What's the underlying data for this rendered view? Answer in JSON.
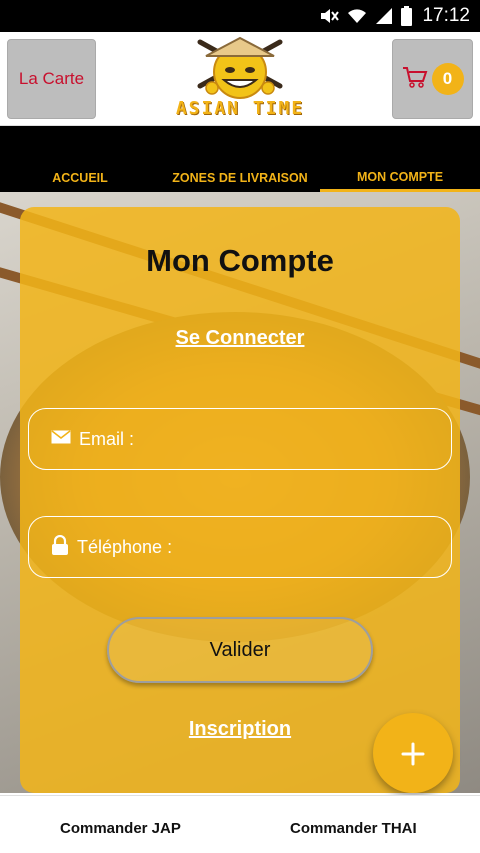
{
  "status_bar": {
    "time": "17:12",
    "icons": [
      "mute-icon",
      "wifi-icon",
      "signal-icon",
      "battery-icon"
    ]
  },
  "header": {
    "left_button_label": "La Carte",
    "cart_count": "0",
    "logo_text": "ASIAN TIME"
  },
  "nav": {
    "tabs": [
      {
        "label": "ACCUEIL",
        "active": false
      },
      {
        "label": "ZONES DE LIVRAISON",
        "active": false
      },
      {
        "label": "MON COMPTE",
        "active": true
      }
    ]
  },
  "account": {
    "title": "Mon Compte",
    "connect_link": "Se Connecter",
    "email_placeholder": "Email :",
    "phone_placeholder": "Téléphone :",
    "submit_label": "Valider",
    "register_link": "Inscription"
  },
  "fab": {
    "icon": "plus-icon"
  },
  "bottom_bar": {
    "left_label": "Commander JAP",
    "right_label": "Commander THAI"
  },
  "colors": {
    "accent": "#f2b318",
    "header_button_bg": "#bdbdbd",
    "carte_text": "#c8102e",
    "nav_bg": "#000000"
  }
}
